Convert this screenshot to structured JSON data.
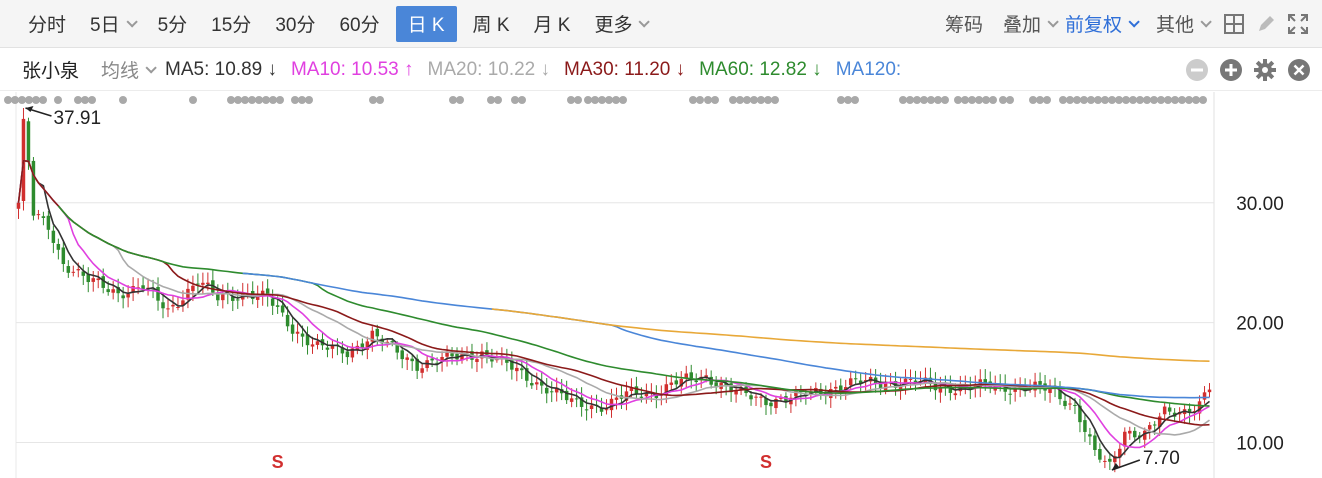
{
  "toolbar": {
    "periods": [
      {
        "label": "分时",
        "active": false,
        "dropdown": false
      },
      {
        "label": "5日",
        "active": false,
        "dropdown": true
      },
      {
        "label": "5分",
        "active": false,
        "dropdown": false
      },
      {
        "label": "15分",
        "active": false,
        "dropdown": false
      },
      {
        "label": "30分",
        "active": false,
        "dropdown": false
      },
      {
        "label": "60分",
        "active": false,
        "dropdown": false
      },
      {
        "label": "日 K",
        "active": true,
        "dropdown": false
      },
      {
        "label": "周 K",
        "active": false,
        "dropdown": false
      },
      {
        "label": "月 K",
        "active": false,
        "dropdown": false
      },
      {
        "label": "更多",
        "active": false,
        "dropdown": true
      }
    ],
    "chips": "筹码",
    "overlay": "叠加",
    "adjust": "前复权",
    "other": "其他",
    "icons": [
      "grid-icon",
      "pen-icon",
      "fullscreen-icon"
    ]
  },
  "ma_bar": {
    "stock_name": "张小泉",
    "selector": "均线",
    "items": [
      {
        "label": "MA5: 10.89 ↓",
        "color": "#333333"
      },
      {
        "label": "MA10: 10.53 ↑",
        "color": "#e040e0"
      },
      {
        "label": "MA20: 10.22 ↓",
        "color": "#aaaaaa"
      },
      {
        "label": "MA30: 11.20 ↓",
        "color": "#8b1a1a"
      },
      {
        "label": "MA60: 12.82 ↓",
        "color": "#2e8b2e"
      },
      {
        "label": "MA120:",
        "color": "#4a86d8"
      }
    ]
  },
  "chart_data": {
    "type": "line",
    "title": "",
    "ylim": [
      7.7,
      37.91
    ],
    "y_ticks": [
      10,
      20,
      30
    ],
    "y_tick_labels": [
      "10.00",
      "20.00",
      "30.00"
    ],
    "annotations": [
      {
        "text": "37.91",
        "value": 37.91,
        "kind": "high"
      },
      {
        "text": "7.70",
        "value": 7.7,
        "kind": "low"
      }
    ],
    "signals": [
      {
        "text": "S",
        "index": 52
      },
      {
        "text": "S",
        "index": 150
      }
    ],
    "n_bars": 240,
    "close_anchors": [
      [
        0,
        30
      ],
      [
        1,
        37.5
      ],
      [
        3,
        29
      ],
      [
        6,
        28
      ],
      [
        9,
        25
      ],
      [
        14,
        23.5
      ],
      [
        20,
        22.5
      ],
      [
        25,
        23
      ],
      [
        30,
        21
      ],
      [
        36,
        23.5
      ],
      [
        40,
        22
      ],
      [
        46,
        22.5
      ],
      [
        50,
        22
      ],
      [
        55,
        19.5
      ],
      [
        60,
        18
      ],
      [
        66,
        17.5
      ],
      [
        71,
        19
      ],
      [
        76,
        17.5
      ],
      [
        80,
        16.5
      ],
      [
        86,
        17
      ],
      [
        93,
        17.5
      ],
      [
        100,
        16
      ],
      [
        106,
        14.5
      ],
      [
        112,
        13.2
      ],
      [
        118,
        13
      ],
      [
        122,
        14
      ],
      [
        128,
        14.2
      ],
      [
        132,
        15
      ],
      [
        138,
        15.5
      ],
      [
        145,
        14
      ],
      [
        150,
        13.5
      ],
      [
        156,
        13.8
      ],
      [
        162,
        14.4
      ],
      [
        168,
        15
      ],
      [
        174,
        15
      ],
      [
        180,
        15
      ],
      [
        186,
        14.6
      ],
      [
        190,
        14.5
      ],
      [
        195,
        14.8
      ],
      [
        200,
        14.5
      ],
      [
        207,
        14.5
      ],
      [
        212,
        13
      ],
      [
        216,
        9
      ],
      [
        219,
        8
      ],
      [
        222,
        11
      ],
      [
        226,
        10.6
      ],
      [
        230,
        12.5
      ],
      [
        234,
        12.7
      ],
      [
        237,
        13.2
      ],
      [
        239,
        14.5
      ]
    ],
    "series": [
      {
        "name": "MA5",
        "period": 5,
        "color": "#333333"
      },
      {
        "name": "MA10",
        "period": 10,
        "color": "#e040e0"
      },
      {
        "name": "MA20",
        "period": 20,
        "color": "#aaaaaa"
      },
      {
        "name": "MA30",
        "period": 30,
        "color": "#8b1a1a"
      },
      {
        "name": "MA60",
        "period": 60,
        "color": "#2e8b2e"
      },
      {
        "name": "MA120",
        "period": 120,
        "color": "#4a86d8"
      },
      {
        "name": "MA250",
        "period": 250,
        "color": "#e8a838"
      }
    ],
    "event_dots_x": [
      [
        5,
        45
      ],
      [
        55,
        60
      ],
      [
        75,
        90
      ],
      [
        120,
        125
      ],
      [
        190,
        195
      ],
      [
        228,
        280
      ],
      [
        292,
        312
      ],
      [
        370,
        380
      ],
      [
        450,
        462
      ],
      [
        488,
        498
      ],
      [
        512,
        524
      ],
      [
        568,
        578
      ],
      [
        585,
        625
      ],
      [
        690,
        700
      ],
      [
        705,
        715
      ],
      [
        730,
        775
      ],
      [
        838,
        855
      ],
      [
        900,
        945
      ],
      [
        955,
        990
      ],
      [
        1000,
        1010
      ],
      [
        1030,
        1045
      ],
      [
        1060,
        1205
      ]
    ],
    "colors": {
      "up": "#d12f2f",
      "down": "#2e8b2e",
      "grid": "#e6e6e6",
      "signal": "#d12f2f"
    }
  }
}
